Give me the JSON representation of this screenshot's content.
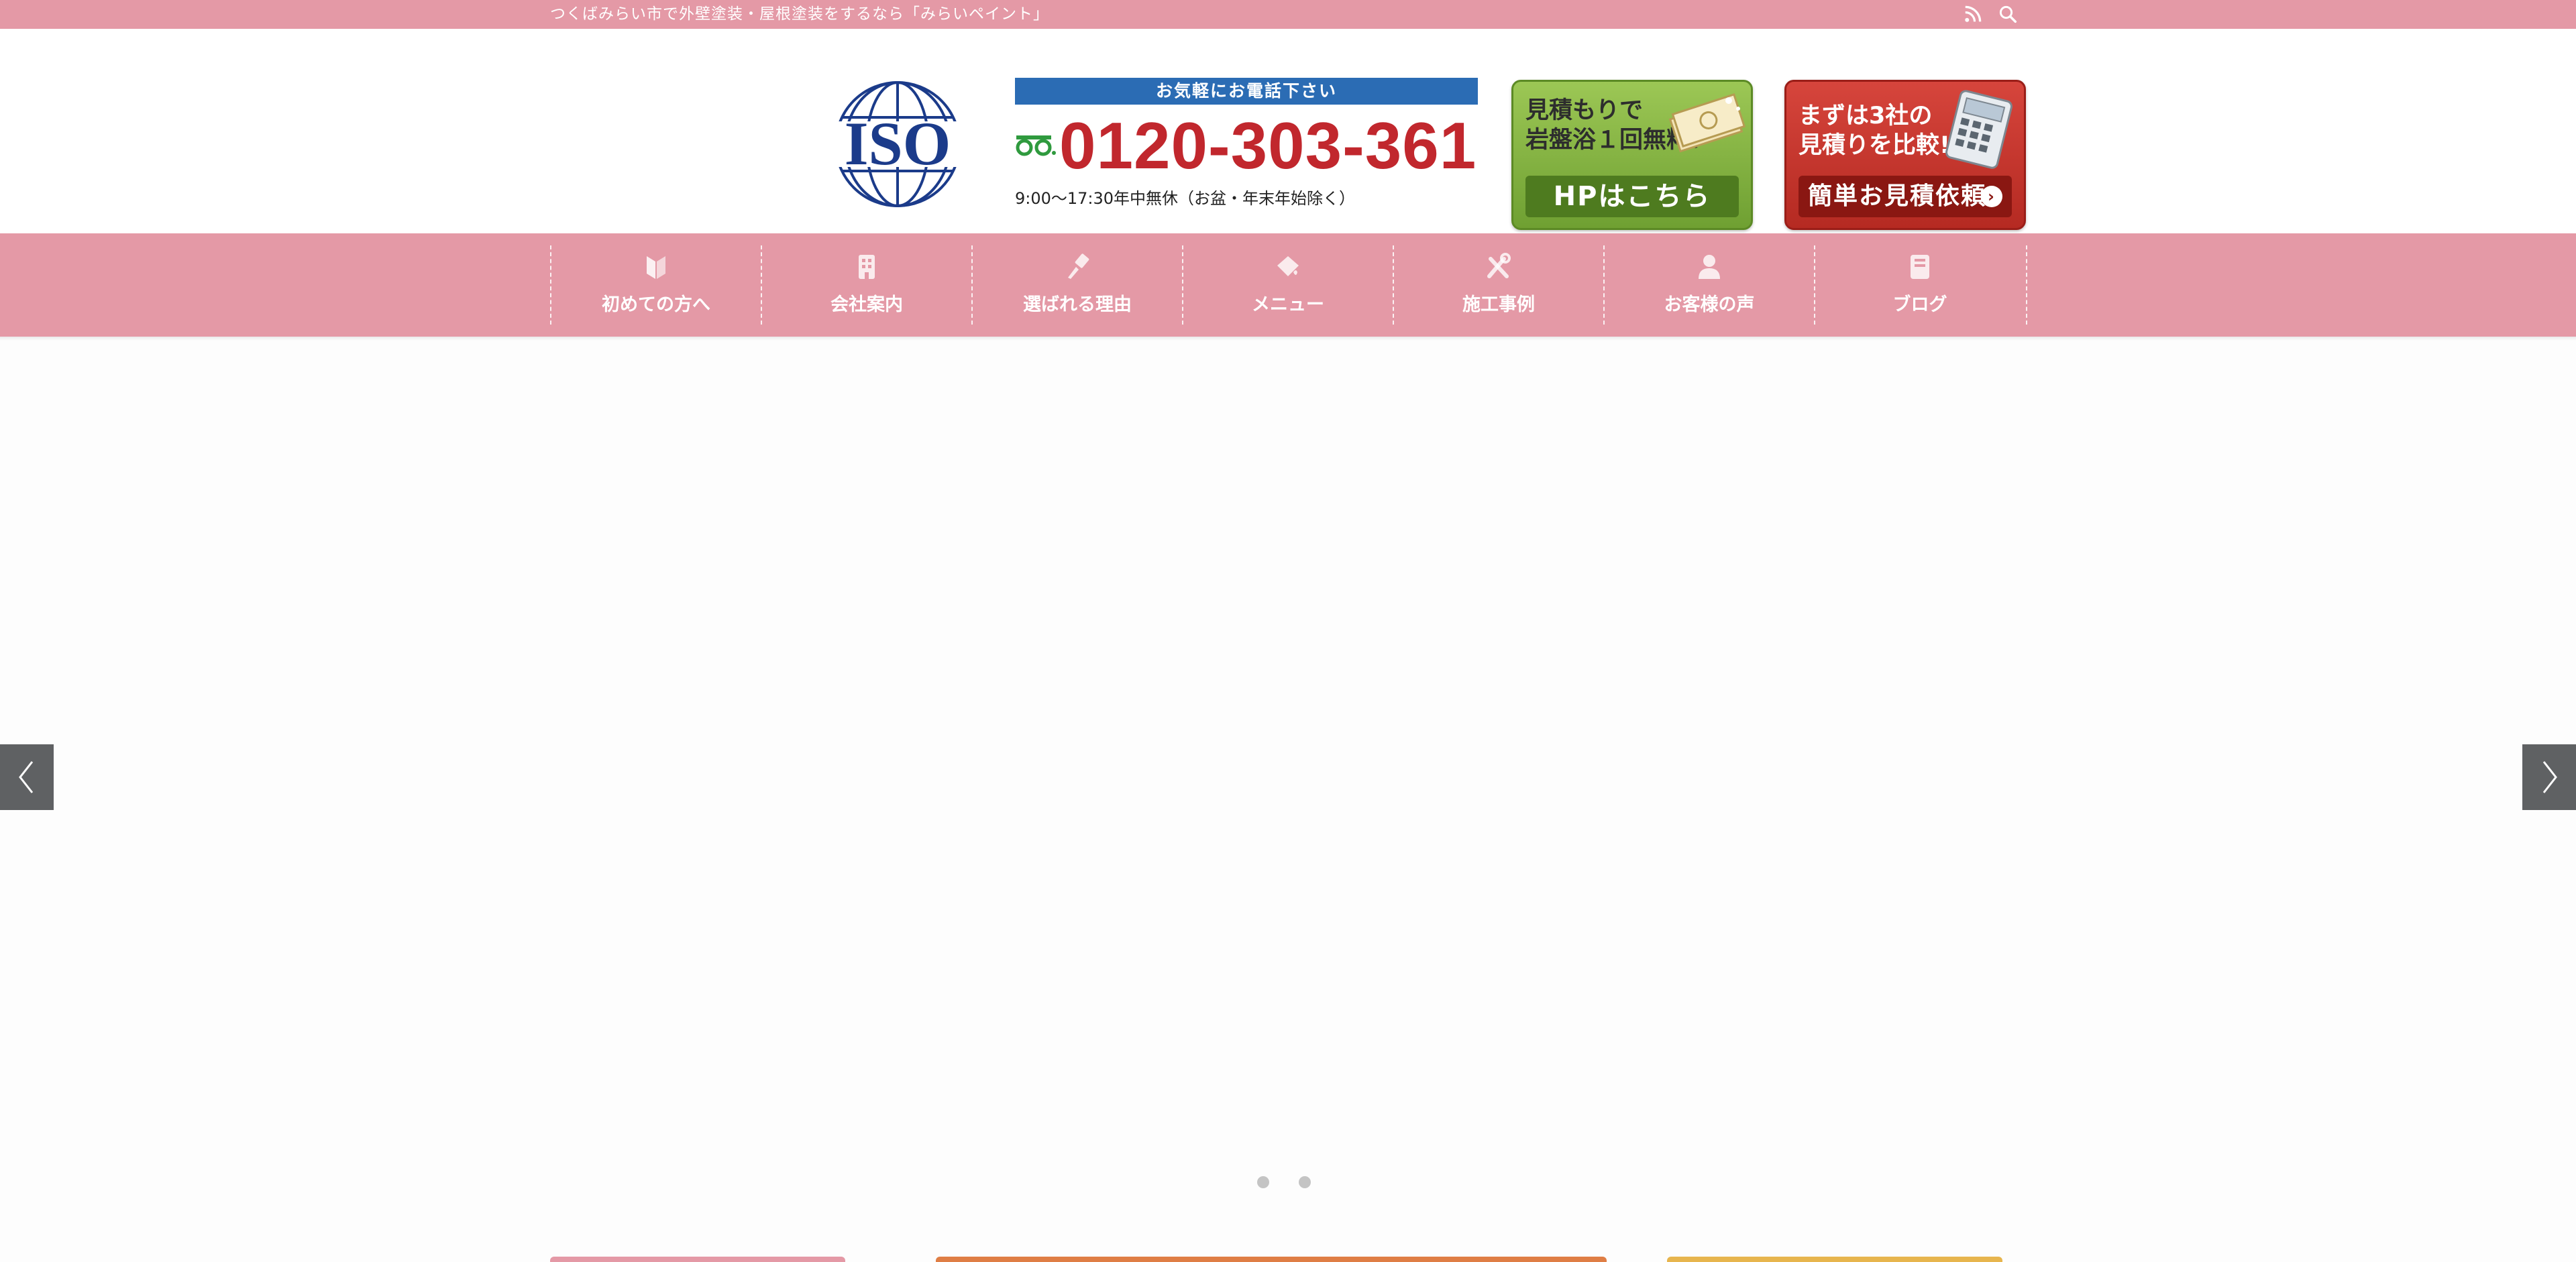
{
  "topbar": {
    "tagline": "つくばみらい市で外壁塗装・屋根塗装をするなら「みらいペイント」",
    "icons": [
      "rss-icon",
      "search-icon"
    ]
  },
  "header": {
    "logo_text": "ISO",
    "call_label": "お気軽にお電話下さい",
    "phone_number": "0120-303-361",
    "hours": "9:00〜17:30年中無休（お盆・年末年始除く）",
    "banner_green": {
      "line1": "見積もりで",
      "line2": "岩盤浴１回無料！",
      "cta": "HPはこちら"
    },
    "banner_red": {
      "line1": "まずは3社の",
      "line2": "見積りを比較!!",
      "cta": "簡単お見積依頼"
    }
  },
  "nav": {
    "items": [
      {
        "label": "初めての方へ",
        "icon": "beginner-icon"
      },
      {
        "label": "会社案内",
        "icon": "building-icon"
      },
      {
        "label": "選ばれる理由",
        "icon": "paintbrush-icon"
      },
      {
        "label": "メニュー",
        "icon": "paint-bucket-icon"
      },
      {
        "label": "施工事例",
        "icon": "tools-icon"
      },
      {
        "label": "お客様の声",
        "icon": "person-icon"
      },
      {
        "label": "ブログ",
        "icon": "book-icon"
      }
    ]
  },
  "slider": {
    "dot_count": 2,
    "active_index": 0
  },
  "colors": {
    "brand_pink": "#e499a6",
    "phone_red": "#c1272d",
    "call_blue": "#2b6cb4",
    "slider_arrow": "#5f6163"
  }
}
